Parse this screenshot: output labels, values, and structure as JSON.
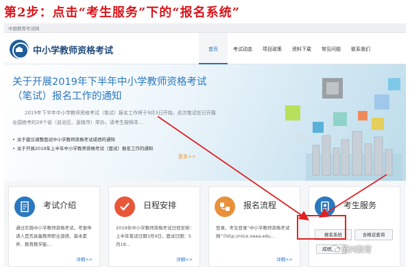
{
  "instruction": "第2步：点击“考生服务”下的“报名系统”",
  "topbar": {
    "text": "中国教育考试网"
  },
  "header": {
    "site_name": "中小学教师资格考试"
  },
  "nav": {
    "items": [
      {
        "label": "首页",
        "active": true
      },
      {
        "label": "考试动态",
        "active": false
      },
      {
        "label": "项目政策",
        "active": false
      },
      {
        "label": "资料下载",
        "active": false
      },
      {
        "label": "常见问题",
        "active": false
      },
      {
        "label": "联系我们",
        "active": false
      }
    ]
  },
  "banner": {
    "headline": "关于开展2019年下半年中小学教师资格考试（笔试）报名工作的通知",
    "summary": "2019年下半年中小学教师资格考试（笔试）报名工作将于9月3日开始，此次笔试在已开展全国统考的28个省（自治区、直辖市）举办，请考生按照本...",
    "bullets": [
      "关于建议调整面试中小学教师资格考试成绩的通知",
      "关于开展2019年上半年中小学教师资格考试（面试）报名工作的通知"
    ],
    "more": "更多>>"
  },
  "cards": [
    {
      "title": "考试介绍",
      "text": "通过实施中小学教师资格考试，考查申请人是否具备教师职业道德、基本素养、教育教学能...",
      "more": "详细>>",
      "icon": "document-icon",
      "color": "#2a78c0"
    },
    {
      "title": "日程安排",
      "text": "2019年中小学教师资格考试日程安排：上半年笔试日期3月9日，面试日期：5月18...",
      "more": "详细>>",
      "icon": "check-icon",
      "color": "#e8573a"
    },
    {
      "title": "报名流程",
      "text": "登录、考生登录“中小学教师资格考试网”（http://ntce.neea.edu...",
      "more": "详细>>",
      "icon": "flow-icon",
      "color": "#e8913a"
    },
    {
      "title": "考生服务",
      "icon": "service-icon",
      "color": "#2a78c0"
    }
  ],
  "service_buttons": {
    "registration": "报名系统",
    "certificate_query": "合格证查询",
    "score_query": "成绩查询"
  },
  "watermark": "佰兴教育",
  "colors": {
    "accent_red": "#d9141b",
    "brand_blue": "#2a78c0",
    "link_orange": "#e8913a"
  }
}
